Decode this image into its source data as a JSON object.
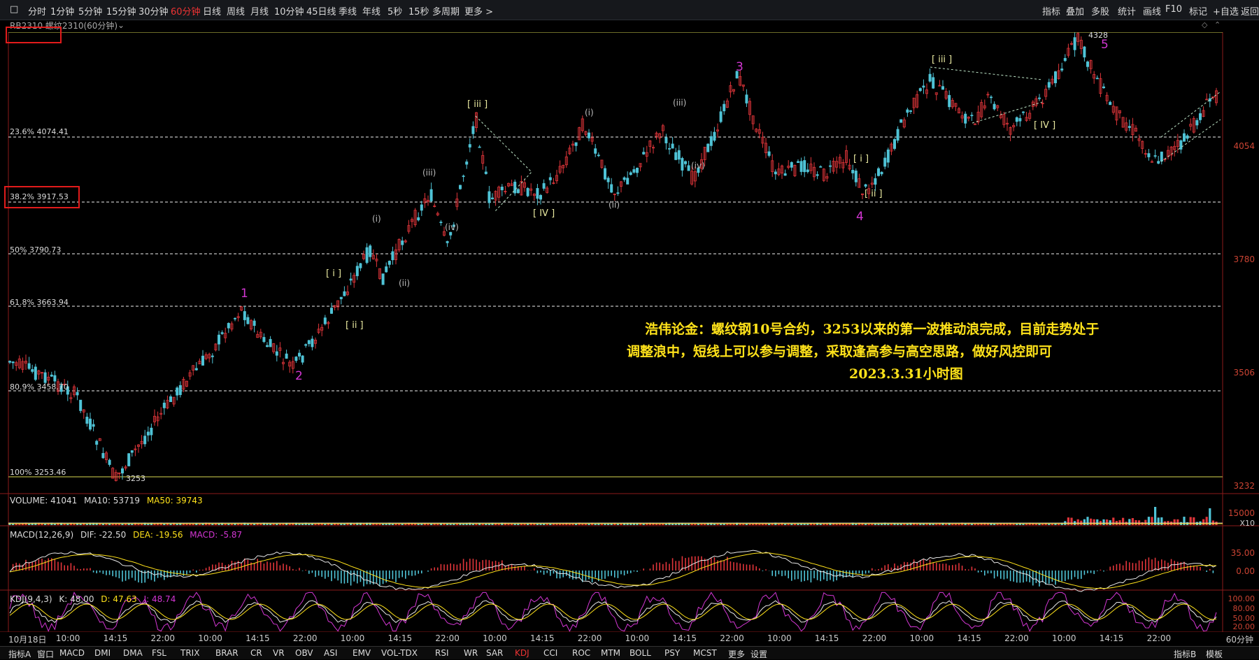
{
  "periods": [
    "分时",
    "1分钟",
    "5分钟",
    "15分钟",
    "30分钟",
    "60分钟",
    "日线",
    "周线",
    "月线",
    "10分钟",
    "45日线",
    "季线",
    "年线",
    "5秒",
    "15秒",
    "多周期",
    "更多 >"
  ],
  "active_period": "60分钟",
  "right_tools": [
    "指标",
    "叠加",
    "多股",
    "统计",
    "画线",
    "F10",
    "标记",
    "+自选",
    "返回"
  ],
  "chart_title": "RB2310 螺纹2310(60分钟)",
  "fib_levels": [
    {
      "label": "23.6% 4074.41"
    },
    {
      "label": "38.2% 3917.53"
    },
    {
      "label": "50% 3790.73"
    },
    {
      "label": "61.8% 3663.94"
    },
    {
      "label": "80.9% 3458.70"
    },
    {
      "label": "100% 3253.46"
    }
  ],
  "price_axis": [
    "4054",
    "3780",
    "3506",
    "3232"
  ],
  "high_label": "4328",
  "low_label": "3253",
  "major_waves": [
    "1",
    "2",
    "3",
    "4",
    "5"
  ],
  "minor_waves": [
    "[ i ]",
    "[ ii ]",
    "[ iii ]",
    "[ IV ]",
    "[ i ]",
    "[ ii ]",
    "[ iii ]",
    "[ IV ]",
    "(i)",
    "(ii)",
    "(iii)",
    "(iv)",
    "(i)",
    "(ii)",
    "(iii)",
    "(iv)"
  ],
  "note": {
    "line1": "浩伟论金：螺纹钢10号合约，3253以来的第一波推动浪完成，目前走势处于",
    "line2": "调整浪中，短线上可以参与调整，采取逢高参与高空思路，做好风控即可",
    "line3": "2023.3.31小时图"
  },
  "volume": {
    "title": "VOLUME: 41041",
    "ma10": "MA10: 53719",
    "ma50": "MA50: 39743",
    "axis": [
      "15000",
      "X10"
    ]
  },
  "macd": {
    "title": "MACD(12,26,9)",
    "dif": "DIF: -22.50",
    "dea": "DEA: -19.56",
    "macd": "MACD: -5.87",
    "axis": [
      "35.00",
      "0.00"
    ]
  },
  "kdj": {
    "title": "KDJ(9,4,3)",
    "k": "K: 48.00",
    "d": "D: 47.63",
    "j": "J: 48.74",
    "axis": [
      "100.00",
      "80.00",
      "50.00",
      "20.00"
    ]
  },
  "time_axis": [
    "10月18日",
    "10:00",
    "14:15",
    "22:00",
    "10:00",
    "14:15",
    "22:00",
    "10:00",
    "14:15",
    "22:00",
    "10:00",
    "14:15",
    "22:00",
    "10:00",
    "14:15",
    "22:00",
    "10:00",
    "14:15",
    "22:00",
    "10:00",
    "14:15",
    "22:00",
    "10:00",
    "14:15",
    "22:00"
  ],
  "time_axis_period": "60分钟",
  "bottom_tabs": [
    "指标A",
    "窗口",
    "MACD",
    "DMI",
    "DMA",
    "FSL",
    "TRIX",
    "BRAR",
    "CR",
    "VR",
    "OBV",
    "ASI",
    "EMV",
    "VOL-TDX",
    "RSI",
    "WR",
    "SAR",
    "KDJ",
    "CCI",
    "ROC",
    "MTM",
    "BOLL",
    "PSY",
    "MCST",
    "更多",
    "设置"
  ],
  "bottom_right": [
    "指标B",
    "模板"
  ],
  "colors": {
    "up": "#e0353a",
    "down": "#4fc3d6",
    "fib_line": "#f0f0f0",
    "wave_major": "#d336d3",
    "note": "#ffe21a",
    "axis_text": "#c43"
  }
}
